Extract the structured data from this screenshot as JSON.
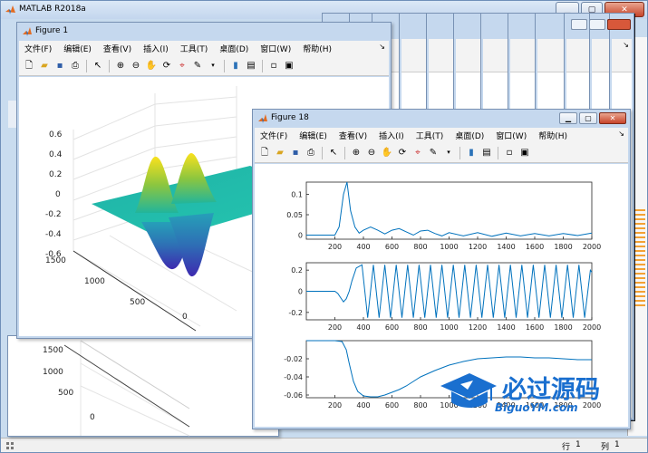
{
  "app": {
    "title": "MATLAB R2018a"
  },
  "statusbar": {
    "row_label": "行",
    "row_value": "1",
    "col_label": "列",
    "col_value": "1"
  },
  "menu": [
    "文件(F)",
    "编辑(E)",
    "查看(V)",
    "插入(I)",
    "工具(T)",
    "桌面(D)",
    "窗口(W)",
    "帮助(H)"
  ],
  "figure1": {
    "title": "Figure 1",
    "zticks": [
      "0.6",
      "0.4",
      "0.2",
      "0",
      "-0.2",
      "-0.4",
      "-0.6"
    ],
    "yticks": [
      "1500",
      "1000",
      "500",
      "0"
    ],
    "behind_yticks": [
      "1500",
      "1000",
      "500",
      "0"
    ]
  },
  "figure18": {
    "title": "Figure 18",
    "dock_glyph": "↘"
  },
  "watermark": {
    "main": "必过源码",
    "sub": "BiguoYM.com"
  },
  "chart_data": [
    {
      "type": "surface",
      "title": "",
      "zlim": [
        -0.6,
        0.6
      ],
      "z_ticks": [
        0.6,
        0.4,
        0.2,
        0,
        -0.2,
        -0.4,
        -0.6
      ],
      "y_ticks": [
        1500,
        1000,
        500,
        0
      ],
      "grid": true
    },
    {
      "type": "line",
      "title": "",
      "xlim": [
        0,
        2000
      ],
      "ylim": [
        -0.01,
        0.13
      ],
      "x_ticks": [
        200,
        400,
        600,
        800,
        1000,
        1200,
        1400,
        1600,
        1800,
        2000
      ],
      "y_ticks": [
        0,
        0.05,
        0.1
      ],
      "series": [
        {
          "x": [
            0,
            100,
            200,
            230,
            260,
            285,
            310,
            340,
            370,
            400,
            450,
            500,
            550,
            600,
            650,
            700,
            750,
            800,
            850,
            900,
            950,
            1000,
            1100,
            1200,
            1300,
            1400,
            1500,
            1600,
            1700,
            1800,
            1900,
            2000
          ],
          "y": [
            0,
            0,
            0,
            0.02,
            0.1,
            0.13,
            0.06,
            0.02,
            0.005,
            0.012,
            0.02,
            0.012,
            0.003,
            0.012,
            0.016,
            0.008,
            0.0,
            0.01,
            0.012,
            0.004,
            -0.002,
            0.006,
            -0.002,
            0.006,
            -0.003,
            0.005,
            -0.002,
            0.004,
            -0.002,
            0.004,
            -0.001,
            0.005
          ]
        }
      ]
    },
    {
      "type": "line",
      "title": "",
      "xlim": [
        0,
        2000
      ],
      "ylim": [
        -0.27,
        0.27
      ],
      "x_ticks": [
        200,
        400,
        600,
        800,
        1000,
        1200,
        1400,
        1600,
        1800,
        2000
      ],
      "y_ticks": [
        0.2,
        0,
        -0.2
      ],
      "series": [
        {
          "x": [
            0,
            100,
            200,
            220,
            240,
            260,
            280,
            300,
            320,
            350,
            390,
            430,
            470,
            510,
            550,
            590,
            630,
            670,
            710,
            750,
            790,
            830,
            870,
            910,
            950,
            990,
            1030,
            1070,
            1110,
            1150,
            1190,
            1230,
            1270,
            1310,
            1350,
            1390,
            1430,
            1470,
            1510,
            1550,
            1590,
            1630,
            1670,
            1710,
            1750,
            1790,
            1830,
            1870,
            1910,
            1950,
            1990,
            2000
          ],
          "y": [
            0,
            0,
            0,
            -0.02,
            -0.06,
            -0.1,
            -0.07,
            0.0,
            0.1,
            0.22,
            0.25,
            -0.25,
            0.25,
            -0.25,
            0.25,
            -0.25,
            0.25,
            -0.25,
            0.25,
            -0.25,
            0.25,
            -0.25,
            0.25,
            -0.25,
            0.25,
            -0.25,
            0.25,
            -0.25,
            0.25,
            -0.25,
            0.25,
            -0.25,
            0.25,
            -0.25,
            0.25,
            -0.25,
            0.25,
            -0.25,
            0.25,
            -0.25,
            0.25,
            -0.25,
            0.25,
            -0.25,
            0.25,
            -0.25,
            0.25,
            -0.25,
            0.25,
            -0.25,
            0.2,
            0.18
          ]
        }
      ]
    },
    {
      "type": "line",
      "title": "",
      "xlim": [
        0,
        2000
      ],
      "ylim": [
        -0.063,
        0
      ],
      "x_ticks": [
        200,
        400,
        600,
        800,
        1000,
        1200,
        1400,
        1600,
        1800,
        2000
      ],
      "y_ticks": [
        -0.02,
        -0.04,
        -0.06
      ],
      "series": [
        {
          "x": [
            0,
            100,
            200,
            250,
            280,
            300,
            330,
            360,
            400,
            450,
            500,
            550,
            600,
            650,
            700,
            750,
            800,
            900,
            1000,
            1100,
            1200,
            1300,
            1400,
            1500,
            1600,
            1700,
            1800,
            1900,
            2000
          ],
          "y": [
            0,
            0,
            0,
            -0.001,
            -0.01,
            -0.025,
            -0.045,
            -0.056,
            -0.061,
            -0.062,
            -0.062,
            -0.06,
            -0.057,
            -0.054,
            -0.05,
            -0.045,
            -0.04,
            -0.033,
            -0.027,
            -0.023,
            -0.02,
            -0.019,
            -0.018,
            -0.018,
            -0.019,
            -0.019,
            -0.02,
            -0.021,
            -0.021
          ]
        }
      ]
    }
  ]
}
